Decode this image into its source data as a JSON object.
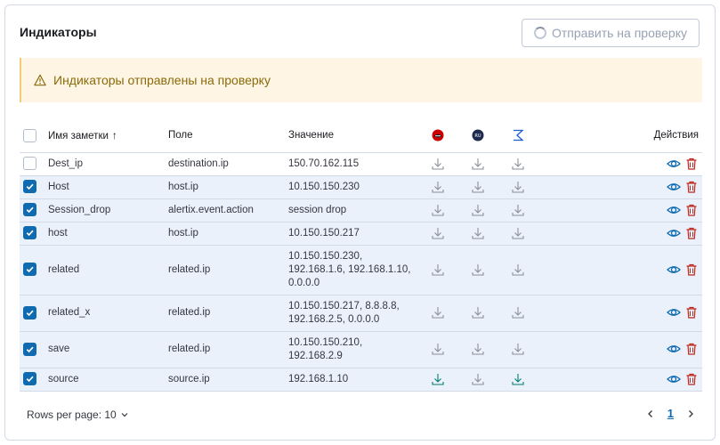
{
  "header": {
    "title": "Индикаторы",
    "send_label": "Отправить на проверку"
  },
  "callout": {
    "text": "Индикаторы отправлены на проверку"
  },
  "table": {
    "columns": {
      "name": "Имя заметки",
      "field": "Поле",
      "value": "Значение",
      "actions": "Действия"
    },
    "rows": [
      {
        "name": "Dest_ip",
        "field": "destination.ip",
        "value": "150.70.162.115",
        "checked": false,
        "height": 26,
        "green": [
          false,
          false,
          false
        ]
      },
      {
        "name": "Host",
        "field": "host.ip",
        "value": "10.150.150.230",
        "checked": true,
        "height": 26,
        "green": [
          false,
          false,
          false
        ]
      },
      {
        "name": "Session_drop",
        "field": "alertix.event.action",
        "value": "session drop",
        "checked": true,
        "height": 26,
        "green": [
          false,
          false,
          false
        ]
      },
      {
        "name": "host",
        "field": "host.ip",
        "value": "10.150.150.217",
        "checked": true,
        "height": 26,
        "green": [
          false,
          false,
          false
        ]
      },
      {
        "name": "related",
        "field": "related.ip",
        "value": "10.150.150.230, 192.168.1.6, 192.168.1.10, 0.0.0.0",
        "checked": true,
        "height": 56,
        "green": [
          false,
          false,
          false
        ]
      },
      {
        "name": "related_x",
        "field": "related.ip",
        "value": "10.150.150.217, 8.8.8.8, 192.168.2.5, 0.0.0.0",
        "checked": true,
        "height": 41,
        "green": [
          false,
          false,
          false
        ]
      },
      {
        "name": "save",
        "field": "related.ip",
        "value": "10.150.150.210, 192.168.2.9",
        "checked": true,
        "height": 41,
        "green": [
          false,
          false,
          false
        ]
      },
      {
        "name": "source",
        "field": "source.ip",
        "value": "192.168.1.10",
        "checked": true,
        "height": 26,
        "green": [
          true,
          false,
          true
        ]
      }
    ]
  },
  "footer": {
    "rows_per_page": "Rows per page: 10",
    "page": "1"
  },
  "colors": {
    "accent": "#0f6aaf",
    "warning_bg": "#fef5e4",
    "selected_row": "#eaf1fa",
    "delete": "#bd271e",
    "green": "#017d73"
  }
}
